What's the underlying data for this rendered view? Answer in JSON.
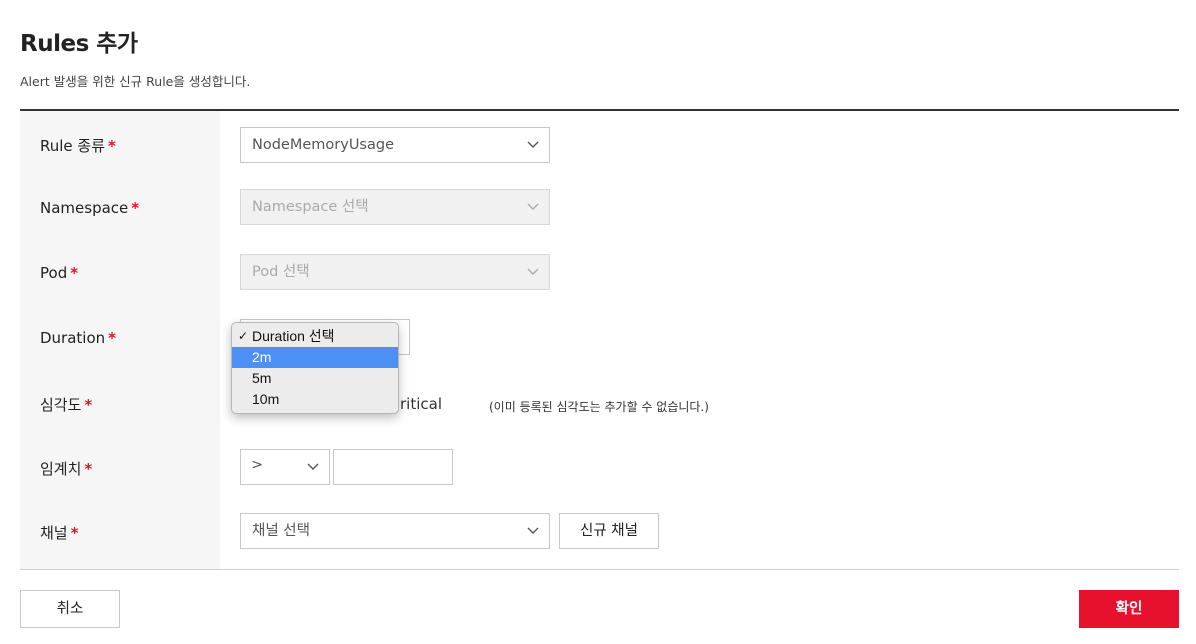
{
  "header": {
    "title": "Rules 추가",
    "description": "Alert 발생을 위한 신규 Rule을 생성합니다."
  },
  "form": {
    "rule_type": {
      "label": "Rule 종류",
      "value": "NodeMemoryUsage"
    },
    "namespace": {
      "label": "Namespace",
      "value": "Namespace 선택"
    },
    "pod": {
      "label": "Pod",
      "value": "Pod 선택"
    },
    "duration": {
      "label": "Duration",
      "options": [
        "Duration 선택",
        "2m",
        "5m",
        "10m"
      ],
      "checkmark": "✓"
    },
    "severity": {
      "label": "심각도",
      "visible_text": "ritical",
      "note": "(이미 등록된 심각도는 추가할 수 없습니다.)"
    },
    "threshold": {
      "label": "임계치",
      "operator": ">",
      "value": ""
    },
    "channel": {
      "label": "채널",
      "value": "채널 선택",
      "new_button": "신규 채널"
    },
    "required_mark": "*"
  },
  "footer": {
    "cancel_label": "취소",
    "confirm_label": "확인"
  },
  "colors": {
    "accent": "#e8112d",
    "highlight": "#4d90f4"
  }
}
